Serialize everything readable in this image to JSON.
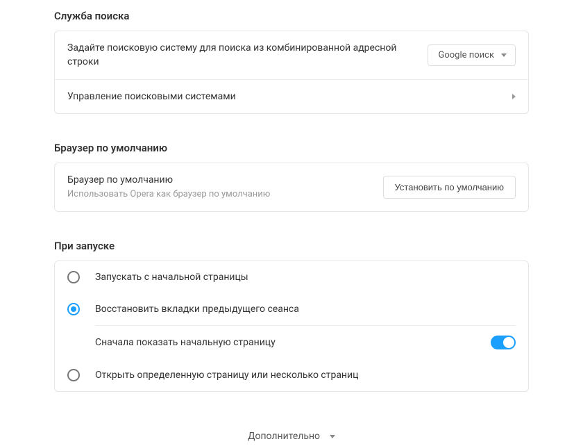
{
  "search": {
    "title": "Служба поиска",
    "engine_desc": "Задайте поисковую систему для поиска из комбинированной адресной строки",
    "engine_selected": "Google поиск",
    "manage_label": "Управление поисковыми системами"
  },
  "default_browser": {
    "title": "Браузер по умолчанию",
    "row_title": "Браузер по умолчанию",
    "row_sub": "Использовать Opera как браузер по умолчанию",
    "button": "Установить по умолчанию"
  },
  "startup": {
    "title": "При запуске",
    "options": [
      {
        "label": "Запускать с начальной страницы",
        "checked": false
      },
      {
        "label": "Восстановить вкладки предыдущего сеанса",
        "checked": true
      },
      {
        "label": "Открыть определенную страницу или несколько страниц",
        "checked": false
      }
    ],
    "sub_option": {
      "label": "Сначала показать начальную страницу",
      "enabled": true
    }
  },
  "advanced_label": "Дополнительно"
}
